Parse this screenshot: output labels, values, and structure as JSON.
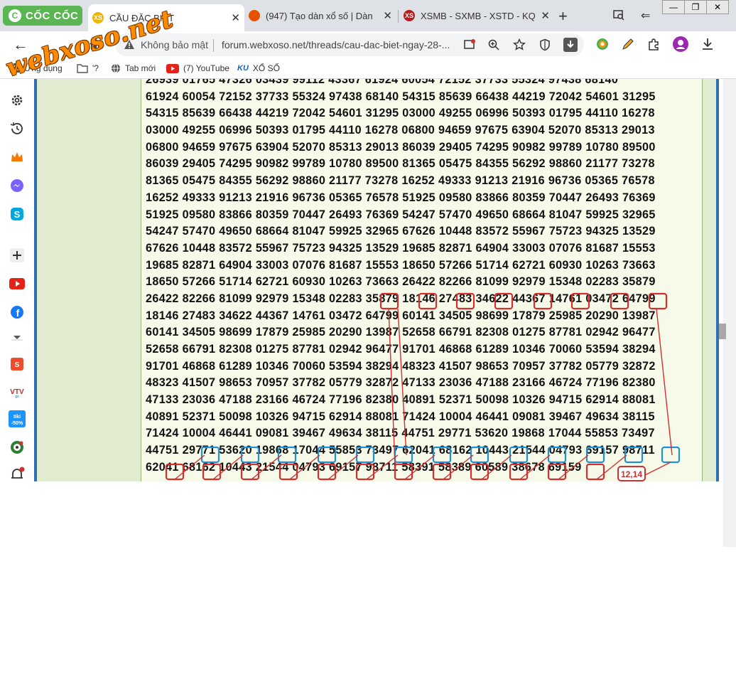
{
  "browser": {
    "logo_text": "CỐC CỐC",
    "tabs": [
      {
        "title": "CẦU ĐẶC BIỆT",
        "favicon": "xs-icon",
        "color": "#f0b400",
        "active": true,
        "prefix": "CẦ"
      },
      {
        "title": "(947) Tạo dàn xổ số | Dàn",
        "favicon": "firefox-like-icon",
        "color": "#e65100",
        "active": false
      },
      {
        "title": "XSMB - SXMB - XSTD - KQ",
        "favicon": "xs-icon",
        "color": "#b71c1c",
        "active": false
      }
    ],
    "new_tab": "+",
    "window_controls": [
      "—",
      "❐",
      "✕"
    ]
  },
  "toolbar": {
    "security_label": "Không bảo mật",
    "url": "forum.webxoso.net/threads/cau-dac-biet-ngay-28-..."
  },
  "bookmarks": [
    {
      "label": "Ứng dụng",
      "icon": "apps-icon"
    },
    {
      "label": "'?",
      "icon": "folder-icon"
    },
    {
      "label": "Tab mới",
      "icon": "globe-icon"
    },
    {
      "label": "(7) YouTube",
      "icon": "youtube-icon"
    },
    {
      "label": "XỔ SỐ",
      "icon": "ku-icon"
    }
  ],
  "watermark": "webxoso.net",
  "sidebar_icons": [
    "settings-icon",
    "history-icon",
    "crown-icon",
    "messenger-icon",
    "skype-icon",
    "add-icon",
    "youtube-icon",
    "facebook-icon",
    "more-icon",
    "shopee-icon",
    "vtv-icon",
    "tiki-icon",
    "football-icon",
    "notification-icon"
  ],
  "lottery_rows": [
    "26939 01765 47326 03439 99112 43367 61924 60054 72152 37733 55324 97438 68140",
    "61924 60054 72152 37733 55324 97438 68140 54315 85639 66438 44219 72042 54601 31295",
    "54315 85639 66438 44219 72042 54601 31295 03000 49255 06996 50393 01795 44110 16278",
    "03000 49255 06996 50393 01795 44110 16278 06800 94659 97675 63904 52070 85313 29013",
    "06800 94659 97675 63904 52070 85313 29013 86039 29405 74295 90982 99789 10780 89500",
    "86039 29405 74295 90982 99789 10780 89500 81365 05475 84355 56292 98860 21177 73278",
    "81365 05475 84355 56292 98860 21177 73278 16252 49333 91213 21916 96736 05365 76578",
    "16252 49333 91213 21916 96736 05365 76578 51925 09580 83866 80359 70447 26493 76369",
    "51925 09580 83866 80359 70447 26493 76369 54247 57470 49650 68664 81047 59925 32965",
    "54247 57470 49650 68664 81047 59925 32965 67626 10448 83572 55967 75723 94325 13529",
    "67626 10448 83572 55967 75723 94325 13529 19685 82871 64904 33003 07076 81687 15553",
    "19685 82871 64904 33003 07076 81687 15553 18650 57266 51714 62721 60930 10263 73663",
    "18650 57266 51714 62721 60930 10263 73663 26422 82266 81099 92979 15348 02283 35879",
    "26422 82266 81099 92979 15348 02283 35879 18146 27483 34622 44367 14761 03472 64799",
    "18146 27483 34622 44367 14761 03472 64799 60141 34505 98699 17879 25985 20290 13987",
    "60141 34505 98699 17879 25985 20290 13987 52658 66791 82308 01275 87781 02942 96477",
    "52658 66791 82308 01275 87781 02942 96477 91701 46868 61289 10346 70060 53594 38294",
    "91701 46868 61289 10346 70060 53594 38294 48323 41507 98653 70957 37782 05779 32872",
    "48323 41507 98653 70957 37782 05779 32872 47133 23036 47188 23166 46724 77196 82380",
    "47133 23036 47188 23166 46724 77196 82380 40891 52371 50098 10326 94715 62914 88081",
    "40891 52371 50098 10326 94715 62914 88081 71424 10004 46441 09081 39467 49634 38115",
    "71424 10004 46441 09081 39467 49634 38115 44751 29771 53620 19868 17044 55853 73497",
    "44751 29771 53620 19868 17044 55853 73497 62041 68162 10443 21544 04793 69157 98711",
    "62041 68162 10443 21544 04793 69157 98711 58391 58389 60589 38678 69159"
  ],
  "annotation_label": "12,14",
  "colors": {
    "red_box": "#d32f2f",
    "blue_box": "#1e90d6",
    "accent_blue": "#2f6fb3",
    "green_bg": "#e2ecd1"
  }
}
